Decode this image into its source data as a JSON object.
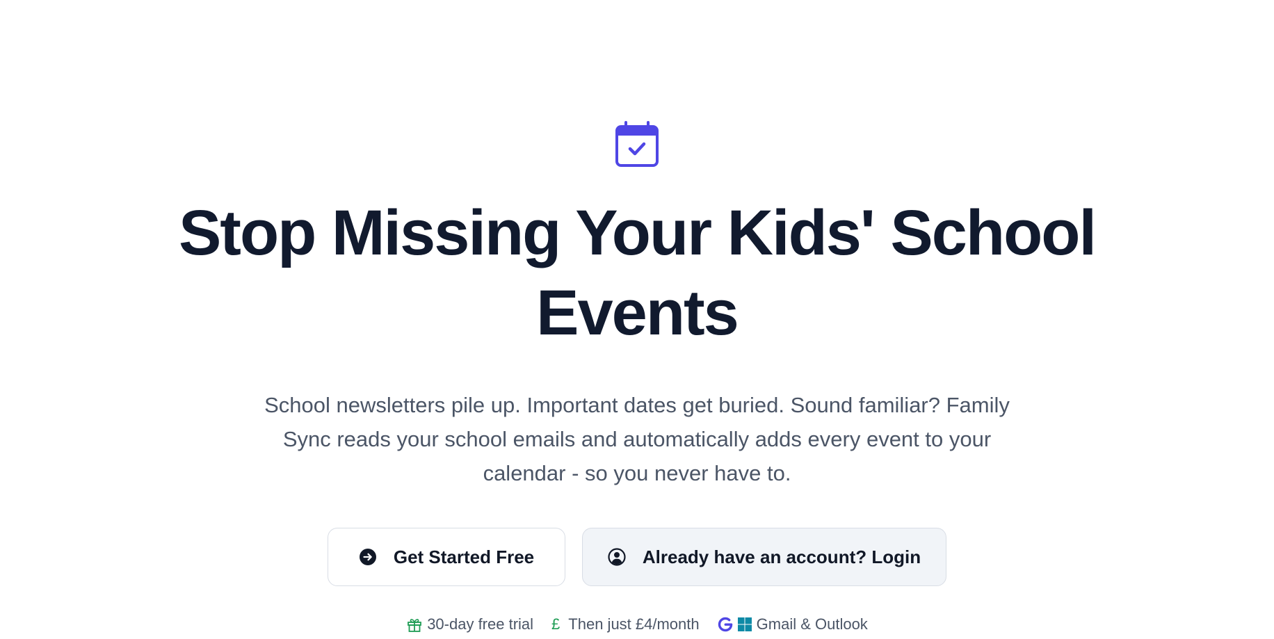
{
  "hero": {
    "title": "Stop Missing Your Kids' School Events",
    "subtitle": "School newsletters pile up. Important dates get buried. Sound familiar? Family Sync reads your school emails and automatically adds every event to your calendar - so you never have to.",
    "logo_icon": "calendar-check-icon",
    "accent_color": "#4f46e5"
  },
  "actions": {
    "primary_label": "Get Started Free",
    "primary_icon": "arrow-right-circle-icon",
    "secondary_label": "Already have an account? Login",
    "secondary_icon": "user-circle-icon"
  },
  "features": [
    {
      "icon": "gift-icon",
      "label": "30-day free trial",
      "color": "#1f9d55"
    },
    {
      "icon": "pound-icon",
      "symbol": "£",
      "label": "Then just £4/month",
      "color": "#1f9d55"
    },
    {
      "icon": "google-microsoft-icon",
      "label": "Gmail & Outlook",
      "color": "#4f46e5"
    }
  ]
}
